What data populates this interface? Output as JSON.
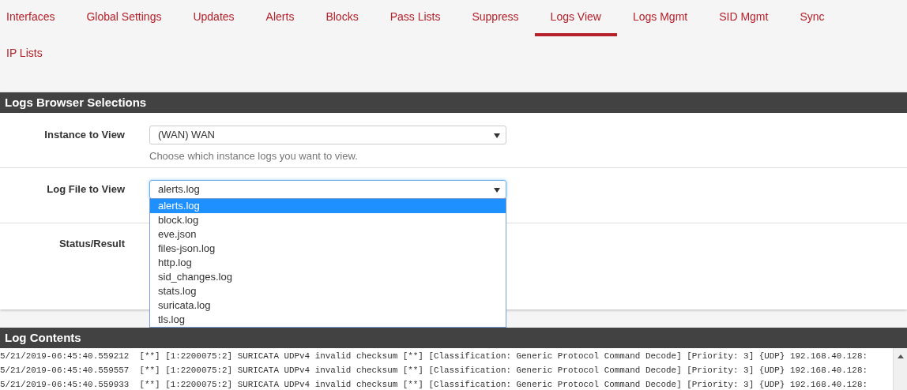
{
  "tabs": [
    {
      "label": "Interfaces",
      "selected": false
    },
    {
      "label": "Global Settings",
      "selected": false
    },
    {
      "label": "Updates",
      "selected": false
    },
    {
      "label": "Alerts",
      "selected": false
    },
    {
      "label": "Blocks",
      "selected": false
    },
    {
      "label": "Pass Lists",
      "selected": false
    },
    {
      "label": "Suppress",
      "selected": false
    },
    {
      "label": "Logs View",
      "selected": true
    },
    {
      "label": "Logs Mgmt",
      "selected": false
    },
    {
      "label": "SID Mgmt",
      "selected": false
    },
    {
      "label": "Sync",
      "selected": false
    },
    {
      "label": "IP Lists",
      "selected": false
    }
  ],
  "selections_panel": {
    "title": "Logs Browser Selections",
    "instance": {
      "label": "Instance to View",
      "value": "(WAN) WAN",
      "help": "Choose which instance logs you want to view."
    },
    "log_file": {
      "label": "Log File to View",
      "value": "alerts.log",
      "expanded": true,
      "options": [
        {
          "label": "alerts.log",
          "selected": true
        },
        {
          "label": "block.log",
          "selected": false
        },
        {
          "label": "eve.json",
          "selected": false
        },
        {
          "label": "files-json.log",
          "selected": false
        },
        {
          "label": "http.log",
          "selected": false
        },
        {
          "label": "sid_changes.log",
          "selected": false
        },
        {
          "label": "stats.log",
          "selected": false
        },
        {
          "label": "suricata.log",
          "selected": false
        },
        {
          "label": "tls.log",
          "selected": false
        }
      ]
    },
    "status": {
      "label": "Status/Result"
    }
  },
  "log_contents": {
    "title": "Log Contents",
    "lines": [
      "5/21/2019-06:45:40.559212  [**] [1:2200075:2] SURICATA UDPv4 invalid checksum [**] [Classification: Generic Protocol Command Decode] [Priority: 3] {UDP} 192.168.40.128:",
      "5/21/2019-06:45:40.559557  [**] [1:2200075:2] SURICATA UDPv4 invalid checksum [**] [Classification: Generic Protocol Command Decode] [Priority: 3] {UDP} 192.168.40.128:",
      "5/21/2019-06:45:40.559933  [**] [1:2200075:2] SURICATA UDPv4 invalid checksum [**] [Classification: Generic Protocol Command Decode] [Priority: 3] {UDP} 192.168.40.128:"
    ]
  }
}
